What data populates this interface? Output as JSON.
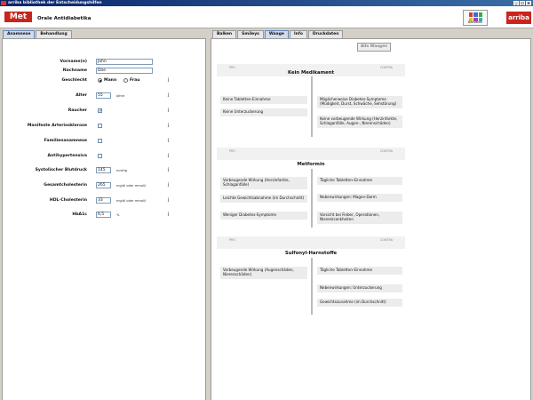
{
  "window": {
    "title": "arriba bibliothek der Entscheidungshilfen"
  },
  "header": {
    "logo": "Met",
    "title": "Orale Antidiabetika",
    "library_label": "Bibliothek",
    "library_colors": [
      "#d63c3c",
      "#3c6cd6",
      "#3caa3c",
      "#e0c030",
      "#a040c0",
      "#30b0c0"
    ],
    "brand_logo": "arriba"
  },
  "left_tabs": [
    {
      "label": "Anamnese",
      "active": true
    },
    {
      "label": "Behandlung",
      "active": false
    }
  ],
  "right_tabs": [
    {
      "label": "Balken",
      "active": false
    },
    {
      "label": "Smileys",
      "active": false
    },
    {
      "label": "Waage",
      "active": true
    },
    {
      "label": "Info",
      "active": false
    },
    {
      "label": "Druckdaten",
      "active": false
    }
  ],
  "form": {
    "first_name": {
      "label": "Vorname(n)",
      "value": "John"
    },
    "last_name": {
      "label": "Nachname",
      "value": "Doe"
    },
    "gender": {
      "label": "Geschlecht",
      "options": [
        "Mann",
        "Frau"
      ],
      "selected": "Mann"
    },
    "age": {
      "label": "Alter",
      "value": "55",
      "unit": "Jahre"
    },
    "smoker": {
      "label": "Raucher",
      "checked": true
    },
    "arteriosclerosis": {
      "label": "Manifeste Arteriosklerose",
      "checked": false
    },
    "family_history": {
      "label": "Familienanamnese",
      "checked": false
    },
    "antihypertensive": {
      "label": "Antihypertensiva",
      "checked": false
    },
    "systolic_bp": {
      "label": "Systolischer Blutdruck",
      "value": "145",
      "unit": "mmHg"
    },
    "total_chol": {
      "label": "Gesamtcholesterin",
      "value": "265",
      "unit": "mg/dl oder mmol/l"
    },
    "hdl_chol": {
      "label": "HDL-Cholesterin",
      "value": "33",
      "unit": "mg/dl oder mmol/l"
    },
    "hba1c": {
      "label": "HbA1c",
      "value": "6,5",
      "unit": "%"
    }
  },
  "all_scales_button": "Alle Waagen",
  "scale_labels": {
    "pro": "PRO",
    "contra": "CONTRA"
  },
  "sections": [
    {
      "name": "Kein Medikament",
      "pro": [
        "Keine Tabletten-Einnahme",
        "Keine Unterzuckerung"
      ],
      "contra": [
        "Möglicherweise Diabetes-Symptome (Müdigkeit, Durst, Schwäche, Sehstörung)",
        "Keine vorbeugende Wirkung (Herzinfarkte, Schlaganfälle, Augen-, Nierenschäden)"
      ]
    },
    {
      "name": "Metformin",
      "pro": [
        "Vorbeugende Wirkung (Herzinfarkte, Schlaganfälle)",
        "Leichte Gewichtsabnahme (im Durchschnitt)",
        "Weniger Diabetes-Symptome"
      ],
      "contra": [
        "Tägliche Tabletten-Einnahme",
        "Nebenwirkungen: Magen-Darm",
        "Vorsicht bei Fieber, Operationen, Nierenkrankheiten"
      ]
    },
    {
      "name": "Sulfonyl-Harnstoffe",
      "pro": [
        "Vorbeugende Wirkung (Augenschäden, Nierenschäden)"
      ],
      "contra": [
        "Tägliche Tabletten-Einnahme",
        "Nebenwirkungen: Unterzuckerung",
        "Gewichtszunahme (im Durchschnitt)"
      ]
    }
  ]
}
